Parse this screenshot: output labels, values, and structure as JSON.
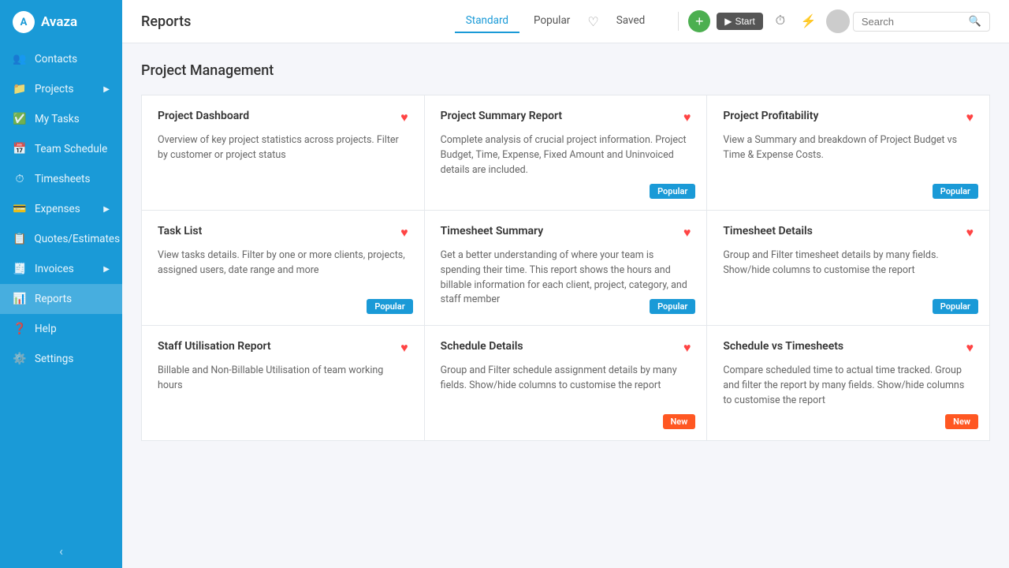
{
  "sidebar": {
    "logo": {
      "icon_text": "A",
      "app_name": "Avaza"
    },
    "items": [
      {
        "id": "contacts",
        "label": "Contacts",
        "icon": "👥"
      },
      {
        "id": "projects",
        "label": "Projects",
        "icon": "📁",
        "has_arrow": true
      },
      {
        "id": "my-tasks",
        "label": "My Tasks",
        "icon": "✅"
      },
      {
        "id": "team-schedule",
        "label": "Team Schedule",
        "icon": "📅"
      },
      {
        "id": "timesheets",
        "label": "Timesheets",
        "icon": "⏱"
      },
      {
        "id": "expenses",
        "label": "Expenses",
        "icon": "💳",
        "has_arrow": true
      },
      {
        "id": "quotes",
        "label": "Quotes/Estimates",
        "icon": "📋"
      },
      {
        "id": "invoices",
        "label": "Invoices",
        "icon": "🧾",
        "has_arrow": true
      },
      {
        "id": "reports",
        "label": "Reports",
        "icon": "📊",
        "active": true
      },
      {
        "id": "help",
        "label": "Help",
        "icon": "❓"
      },
      {
        "id": "settings",
        "label": "Settings",
        "icon": "⚙️"
      }
    ],
    "collapse_label": "‹"
  },
  "header": {
    "title": "Reports",
    "tabs": [
      {
        "id": "standard",
        "label": "Standard",
        "active": true
      },
      {
        "id": "popular",
        "label": "Popular",
        "active": false
      },
      {
        "id": "saved",
        "label": "Saved",
        "active": false
      }
    ],
    "search_placeholder": "Search",
    "actions": {
      "add_label": "+",
      "start_label": "Start"
    }
  },
  "main": {
    "section_title": "Project Management",
    "cards": [
      {
        "id": "project-dashboard",
        "title": "Project Dashboard",
        "description": "Overview of key project statistics across projects. Filter by customer or project status",
        "badge": null
      },
      {
        "id": "project-summary-report",
        "title": "Project Summary Report",
        "description": "Complete analysis of crucial project information. Project Budget, Time, Expense, Fixed Amount and Uninvoiced details are included.",
        "badge": "Popular"
      },
      {
        "id": "project-profitability",
        "title": "Project Profitability",
        "description": "View a Summary and breakdown of Project Budget vs Time & Expense Costs.",
        "badge": "Popular"
      },
      {
        "id": "task-list",
        "title": "Task List",
        "description": "View tasks details. Filter by one or more clients, projects, assigned users, date range and more",
        "badge": "Popular"
      },
      {
        "id": "timesheet-summary",
        "title": "Timesheet Summary",
        "description": "Get a better understanding of where your team is spending their time. This report shows the hours and billable information for each client, project, category, and staff member",
        "badge": "Popular"
      },
      {
        "id": "timesheet-details",
        "title": "Timesheet Details",
        "description": "Group and Filter timesheet details by many fields. Show/hide columns to customise the report",
        "badge": "Popular"
      },
      {
        "id": "staff-utilisation-report",
        "title": "Staff Utilisation Report",
        "description": "Billable and Non-Billable Utilisation of team working hours",
        "badge": null
      },
      {
        "id": "schedule-details",
        "title": "Schedule Details",
        "description": "Group and Filter schedule assignment details by many fields. Show/hide columns to customise the report",
        "badge": "New"
      },
      {
        "id": "schedule-vs-timesheets",
        "title": "Schedule vs Timesheets",
        "description": "Compare scheduled time to actual time tracked. Group and filter the report by many fields. Show/hide columns to customise the report",
        "badge": "New"
      }
    ]
  }
}
